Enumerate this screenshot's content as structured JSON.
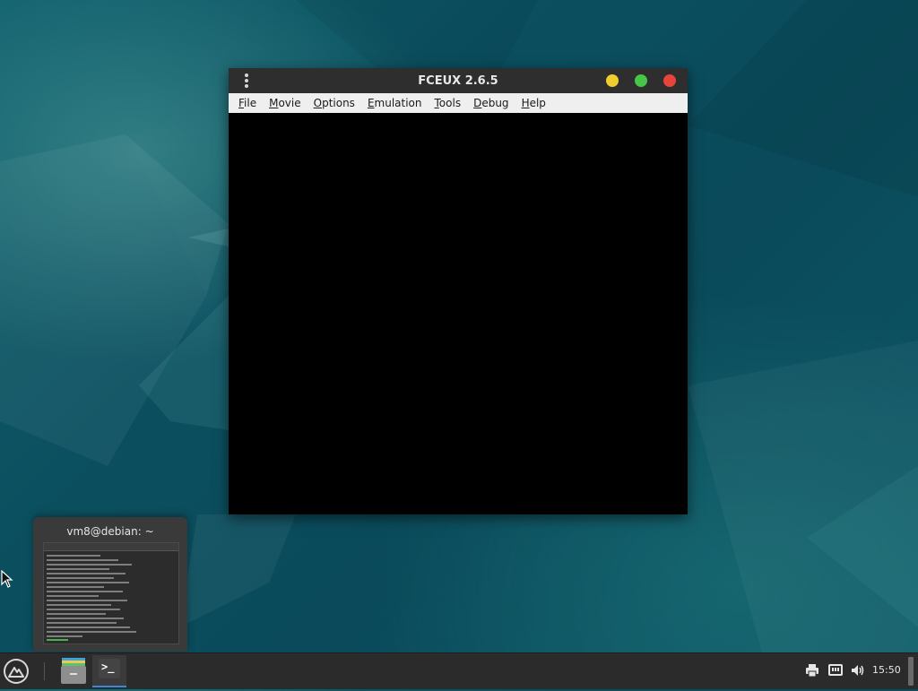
{
  "window": {
    "title": "FCEUX 2.6.5",
    "menu": [
      {
        "label": "File",
        "mnemonic": "F",
        "rest": "ile"
      },
      {
        "label": "Movie",
        "mnemonic": "M",
        "rest": "ovie"
      },
      {
        "label": "Options",
        "mnemonic": "O",
        "rest": "ptions"
      },
      {
        "label": "Emulation",
        "mnemonic": "E",
        "rest": "mulation"
      },
      {
        "label": "Tools",
        "mnemonic": "T",
        "rest": "ools"
      },
      {
        "label": "Debug",
        "mnemonic": "D",
        "rest": "ebug"
      },
      {
        "label": "Help",
        "mnemonic": "H",
        "rest": "elp"
      }
    ],
    "controls": {
      "minimize_color": "#f0cc2e",
      "maximize_color": "#47c549",
      "close_color": "#e8443a"
    }
  },
  "preview": {
    "title": "vm8@debian: ~"
  },
  "taskbar": {
    "start_icon": "distro-logo-icon",
    "apps": [
      {
        "name": "files",
        "icon": "file-manager-icon",
        "active": false
      },
      {
        "name": "terminal",
        "icon": "terminal-icon",
        "active": true,
        "glyph": ">_"
      }
    ],
    "tray_icons": [
      "printer-icon",
      "network-icon",
      "volume-icon"
    ],
    "clock": "15:50",
    "accent": "#3d86d8"
  }
}
